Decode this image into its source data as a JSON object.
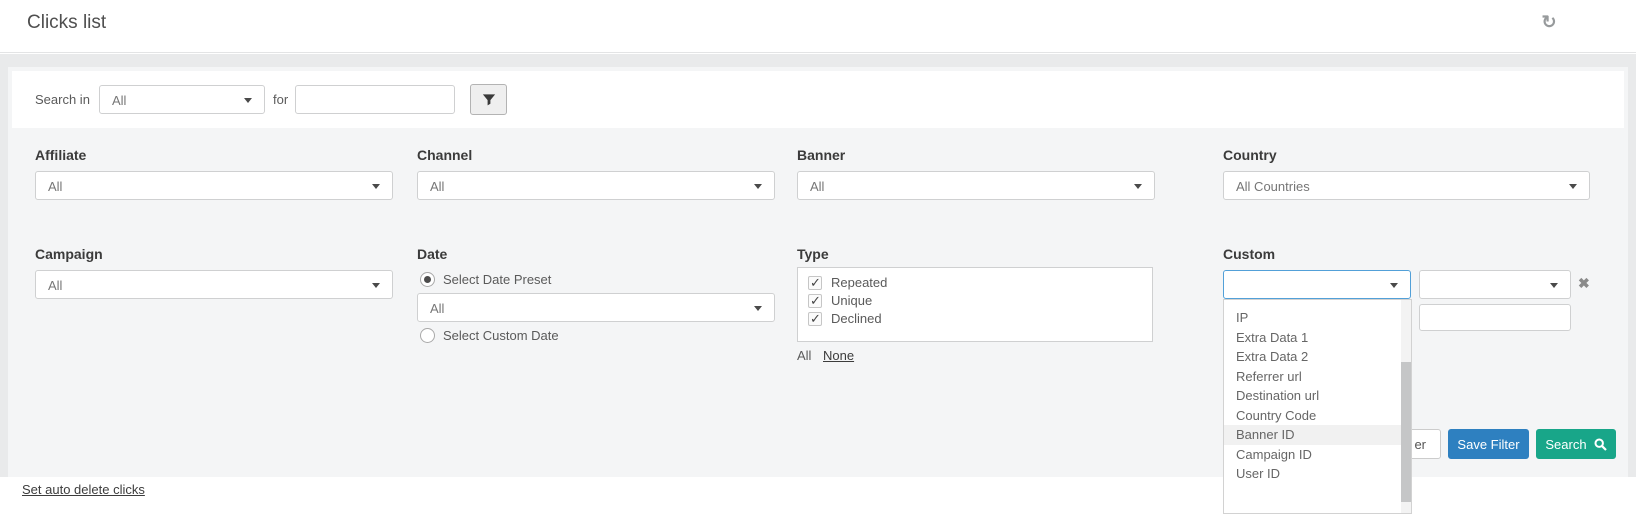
{
  "colors": {
    "accent_blue": "#2e80c0",
    "accent_green": "#18a689",
    "open_select_border": "#52a0d8"
  },
  "header": {
    "title": "Clicks list"
  },
  "search_bar": {
    "search_in_label": "Search in",
    "field_value": "All",
    "for_label": "for",
    "term_value": ""
  },
  "filters": {
    "affiliate": {
      "label": "Affiliate",
      "value": "All"
    },
    "channel": {
      "label": "Channel",
      "value": "All"
    },
    "banner": {
      "label": "Banner",
      "value": "All"
    },
    "country": {
      "label": "Country",
      "value": "All Countries"
    },
    "campaign": {
      "label": "Campaign",
      "value": "All"
    },
    "date": {
      "label": "Date",
      "preset_radio_label": "Select Date Preset",
      "preset_selected": true,
      "preset_value": "All",
      "custom_radio_label": "Select Custom Date",
      "custom_selected": false
    },
    "type": {
      "label": "Type",
      "options": [
        {
          "label": "Repeated",
          "checked": true
        },
        {
          "label": "Unique",
          "checked": true
        },
        {
          "label": "Declined",
          "checked": true
        }
      ],
      "select_all_label": "All",
      "select_none_label": "None"
    },
    "custom": {
      "label": "Custom",
      "field_value": "",
      "operator_value": "",
      "value_input": "",
      "dropdown": {
        "options": [
          "IP",
          "Extra Data 1",
          "Extra Data 2",
          "Referrer url",
          "Destination url",
          "Country Code",
          "Banner ID",
          "Campaign ID",
          "User ID"
        ],
        "highlighted_option": "Banner ID"
      }
    }
  },
  "actions": {
    "reset_button_visible_text": "er",
    "save_filter_label": "Save Filter",
    "search_label": "Search"
  },
  "footer": {
    "auto_delete_link": "Set auto delete clicks"
  }
}
